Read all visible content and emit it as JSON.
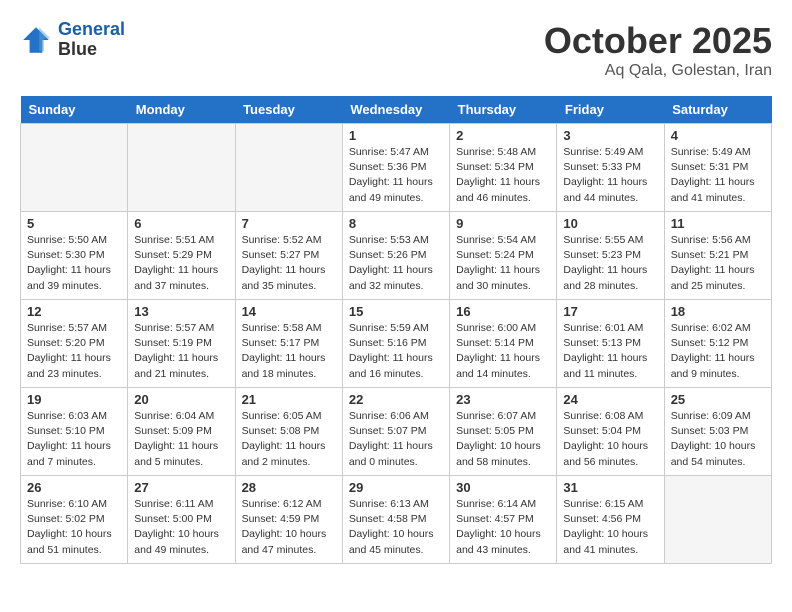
{
  "header": {
    "logo_line1": "General",
    "logo_line2": "Blue",
    "month": "October 2025",
    "location": "Aq Qala, Golestan, Iran"
  },
  "days_of_week": [
    "Sunday",
    "Monday",
    "Tuesday",
    "Wednesday",
    "Thursday",
    "Friday",
    "Saturday"
  ],
  "weeks": [
    [
      {
        "num": "",
        "info": ""
      },
      {
        "num": "",
        "info": ""
      },
      {
        "num": "",
        "info": ""
      },
      {
        "num": "1",
        "info": "Sunrise: 5:47 AM\nSunset: 5:36 PM\nDaylight: 11 hours\nand 49 minutes."
      },
      {
        "num": "2",
        "info": "Sunrise: 5:48 AM\nSunset: 5:34 PM\nDaylight: 11 hours\nand 46 minutes."
      },
      {
        "num": "3",
        "info": "Sunrise: 5:49 AM\nSunset: 5:33 PM\nDaylight: 11 hours\nand 44 minutes."
      },
      {
        "num": "4",
        "info": "Sunrise: 5:49 AM\nSunset: 5:31 PM\nDaylight: 11 hours\nand 41 minutes."
      }
    ],
    [
      {
        "num": "5",
        "info": "Sunrise: 5:50 AM\nSunset: 5:30 PM\nDaylight: 11 hours\nand 39 minutes."
      },
      {
        "num": "6",
        "info": "Sunrise: 5:51 AM\nSunset: 5:29 PM\nDaylight: 11 hours\nand 37 minutes."
      },
      {
        "num": "7",
        "info": "Sunrise: 5:52 AM\nSunset: 5:27 PM\nDaylight: 11 hours\nand 35 minutes."
      },
      {
        "num": "8",
        "info": "Sunrise: 5:53 AM\nSunset: 5:26 PM\nDaylight: 11 hours\nand 32 minutes."
      },
      {
        "num": "9",
        "info": "Sunrise: 5:54 AM\nSunset: 5:24 PM\nDaylight: 11 hours\nand 30 minutes."
      },
      {
        "num": "10",
        "info": "Sunrise: 5:55 AM\nSunset: 5:23 PM\nDaylight: 11 hours\nand 28 minutes."
      },
      {
        "num": "11",
        "info": "Sunrise: 5:56 AM\nSunset: 5:21 PM\nDaylight: 11 hours\nand 25 minutes."
      }
    ],
    [
      {
        "num": "12",
        "info": "Sunrise: 5:57 AM\nSunset: 5:20 PM\nDaylight: 11 hours\nand 23 minutes."
      },
      {
        "num": "13",
        "info": "Sunrise: 5:57 AM\nSunset: 5:19 PM\nDaylight: 11 hours\nand 21 minutes."
      },
      {
        "num": "14",
        "info": "Sunrise: 5:58 AM\nSunset: 5:17 PM\nDaylight: 11 hours\nand 18 minutes."
      },
      {
        "num": "15",
        "info": "Sunrise: 5:59 AM\nSunset: 5:16 PM\nDaylight: 11 hours\nand 16 minutes."
      },
      {
        "num": "16",
        "info": "Sunrise: 6:00 AM\nSunset: 5:14 PM\nDaylight: 11 hours\nand 14 minutes."
      },
      {
        "num": "17",
        "info": "Sunrise: 6:01 AM\nSunset: 5:13 PM\nDaylight: 11 hours\nand 11 minutes."
      },
      {
        "num": "18",
        "info": "Sunrise: 6:02 AM\nSunset: 5:12 PM\nDaylight: 11 hours\nand 9 minutes."
      }
    ],
    [
      {
        "num": "19",
        "info": "Sunrise: 6:03 AM\nSunset: 5:10 PM\nDaylight: 11 hours\nand 7 minutes."
      },
      {
        "num": "20",
        "info": "Sunrise: 6:04 AM\nSunset: 5:09 PM\nDaylight: 11 hours\nand 5 minutes."
      },
      {
        "num": "21",
        "info": "Sunrise: 6:05 AM\nSunset: 5:08 PM\nDaylight: 11 hours\nand 2 minutes."
      },
      {
        "num": "22",
        "info": "Sunrise: 6:06 AM\nSunset: 5:07 PM\nDaylight: 11 hours\nand 0 minutes."
      },
      {
        "num": "23",
        "info": "Sunrise: 6:07 AM\nSunset: 5:05 PM\nDaylight: 10 hours\nand 58 minutes."
      },
      {
        "num": "24",
        "info": "Sunrise: 6:08 AM\nSunset: 5:04 PM\nDaylight: 10 hours\nand 56 minutes."
      },
      {
        "num": "25",
        "info": "Sunrise: 6:09 AM\nSunset: 5:03 PM\nDaylight: 10 hours\nand 54 minutes."
      }
    ],
    [
      {
        "num": "26",
        "info": "Sunrise: 6:10 AM\nSunset: 5:02 PM\nDaylight: 10 hours\nand 51 minutes."
      },
      {
        "num": "27",
        "info": "Sunrise: 6:11 AM\nSunset: 5:00 PM\nDaylight: 10 hours\nand 49 minutes."
      },
      {
        "num": "28",
        "info": "Sunrise: 6:12 AM\nSunset: 4:59 PM\nDaylight: 10 hours\nand 47 minutes."
      },
      {
        "num": "29",
        "info": "Sunrise: 6:13 AM\nSunset: 4:58 PM\nDaylight: 10 hours\nand 45 minutes."
      },
      {
        "num": "30",
        "info": "Sunrise: 6:14 AM\nSunset: 4:57 PM\nDaylight: 10 hours\nand 43 minutes."
      },
      {
        "num": "31",
        "info": "Sunrise: 6:15 AM\nSunset: 4:56 PM\nDaylight: 10 hours\nand 41 minutes."
      },
      {
        "num": "",
        "info": ""
      }
    ]
  ]
}
